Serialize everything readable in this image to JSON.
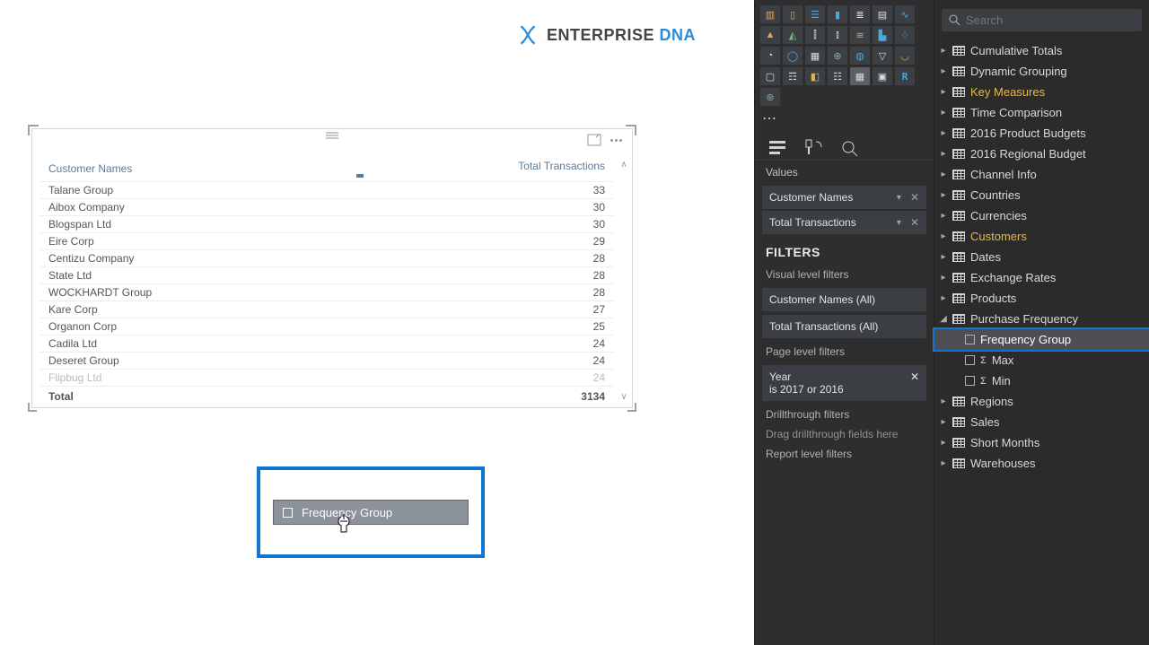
{
  "logo": {
    "primary": "ENTERPRISE",
    "accent": "DNA"
  },
  "table": {
    "headers": [
      "Customer Names",
      "Total Transactions"
    ],
    "rows": [
      [
        "Talane Group",
        "33"
      ],
      [
        "Aibox Company",
        "30"
      ],
      [
        "Blogspan Ltd",
        "30"
      ],
      [
        "Eire Corp",
        "29"
      ],
      [
        "Centizu Company",
        "28"
      ],
      [
        "State Ltd",
        "28"
      ],
      [
        "WOCKHARDT Group",
        "28"
      ],
      [
        "Kare Corp",
        "27"
      ],
      [
        "Organon Corp",
        "25"
      ],
      [
        "Cadila Ltd",
        "24"
      ],
      [
        "Deseret Group",
        "24"
      ],
      [
        "Flipbug Ltd",
        "24"
      ]
    ],
    "footer": [
      "Total",
      "3134"
    ]
  },
  "drag": {
    "label": "Frequency Group"
  },
  "viz": {
    "values_label": "Values",
    "values": [
      "Customer Names",
      "Total Transactions"
    ],
    "filters_title": "FILTERS",
    "visual_filters_label": "Visual level filters",
    "visual_filters": [
      "Customer Names  (All)",
      "Total Transactions  (All)"
    ],
    "page_filters_label": "Page level filters",
    "page_filter": {
      "name": "Year",
      "value": "is 2017 or 2016"
    },
    "drill_label": "Drillthrough filters",
    "drill_placeholder": "Drag drillthrough fields here",
    "report_filters_label": "Report level filters"
  },
  "search": {
    "placeholder": "Search"
  },
  "fields": [
    {
      "label": "Cumulative Totals",
      "level": 0
    },
    {
      "label": "Dynamic Grouping",
      "level": 0
    },
    {
      "label": "Key Measures",
      "level": 0,
      "gold": true
    },
    {
      "label": "Time Comparison",
      "level": 0
    },
    {
      "label": "2016 Product Budgets",
      "level": 0
    },
    {
      "label": "2016 Regional Budget",
      "level": 0
    },
    {
      "label": "Channel Info",
      "level": 0
    },
    {
      "label": "Countries",
      "level": 0
    },
    {
      "label": "Currencies",
      "level": 0
    },
    {
      "label": "Customers",
      "level": 0,
      "gold": true
    },
    {
      "label": "Dates",
      "level": 0
    },
    {
      "label": "Exchange Rates",
      "level": 0
    },
    {
      "label": "Products",
      "level": 0
    },
    {
      "label": "Purchase Frequency",
      "level": 0,
      "expanded": true
    },
    {
      "label": "Frequency Group",
      "level": 1,
      "selected": true
    },
    {
      "label": "Max",
      "level": 1,
      "sigma": true
    },
    {
      "label": "Min",
      "level": 1,
      "sigma": true
    },
    {
      "label": "Regions",
      "level": 0
    },
    {
      "label": "Sales",
      "level": 0
    },
    {
      "label": "Short Months",
      "level": 0
    },
    {
      "label": "Warehouses",
      "level": 0
    }
  ]
}
